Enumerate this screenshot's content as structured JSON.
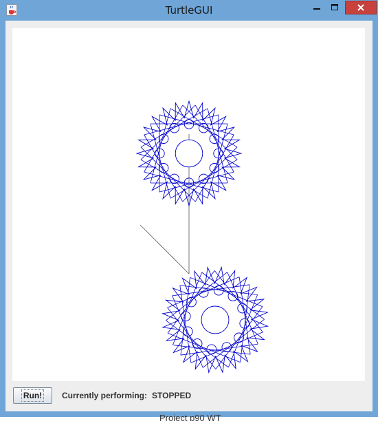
{
  "window": {
    "title": "TurtleGUI",
    "icons": {
      "app": "java-coffee-cup-icon",
      "minimize": "minimize-icon",
      "maximize": "maximize-icon",
      "close": "close-icon"
    }
  },
  "controls": {
    "run_label": "Run!",
    "status_label": "Currently performing:",
    "status_value": "STOPPED"
  },
  "background_text": "Project p90 WT",
  "colors": {
    "window_frame": "#6fa5d7",
    "close_button": "#c8423d",
    "drawing_stroke": "#0000cc",
    "turtle_path": "#555555"
  }
}
